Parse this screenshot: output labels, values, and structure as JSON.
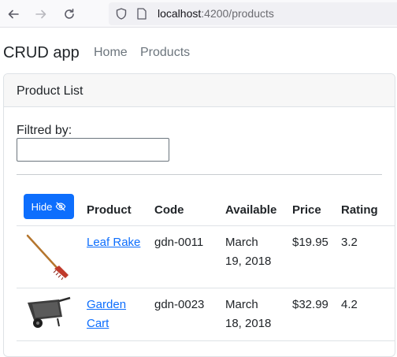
{
  "browser": {
    "url_host": "localhost",
    "url_rest": ":4200/products"
  },
  "app": {
    "brand": "CRUD app",
    "nav": [
      "Home",
      "Products"
    ]
  },
  "card": {
    "title": "Product List",
    "filter_label": "Filtred by:",
    "filter_value": ""
  },
  "table": {
    "hide_button": "Hide",
    "headers": [
      "Product",
      "Code",
      "Available",
      "Price",
      "Rating"
    ],
    "rows": [
      {
        "product_line1": "Leaf Rake",
        "product_line2": "",
        "code": "gdn-0011",
        "available_line1": "March",
        "available_line2": "19, 2018",
        "price": "$19.95",
        "rating": "3.2"
      },
      {
        "product_line1": "Garden",
        "product_line2": "Cart",
        "code": "gdn-0023",
        "available_line1": "March",
        "available_line2": "18, 2018",
        "price": "$32.99",
        "rating": "4.2"
      }
    ]
  }
}
